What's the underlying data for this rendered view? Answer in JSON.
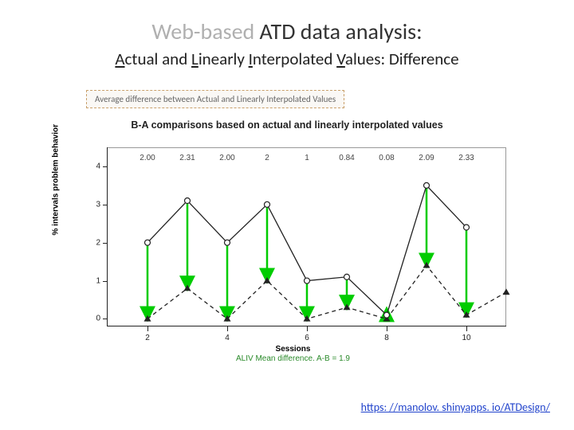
{
  "title_faded": "Web-based ",
  "title_main": "ATD data analysis:",
  "subtitle_parts": [
    "A",
    "ctual and ",
    "L",
    "inearly ",
    "I",
    "nterpolated ",
    "V",
    "alues: Difference"
  ],
  "legend_text": "Average difference between Actual and Linearly Interpolated Values",
  "chart_title": "B-A comparisons based on actual and linearly interpolated values",
  "y_axis_title": "% intervals problem behavior",
  "x_axis_title": "Sessions",
  "aliv_text": "ALIV Mean difference. A-B =  1.9",
  "footer_url": "https: //manolov. shinyapps. io/ATDesign/",
  "chart_data": {
    "type": "line",
    "xlabel": "Sessions",
    "ylabel": "% intervals problem behavior",
    "x_ticks": [
      2,
      4,
      6,
      8,
      10
    ],
    "y_ticks": [
      0,
      1,
      2,
      3,
      4
    ],
    "ylim": [
      -0.2,
      4.5
    ],
    "xlim": [
      1,
      11
    ],
    "series": [
      {
        "name": "upper (open circles, solid)",
        "style": "solid",
        "marker": "open-circle",
        "x": [
          2,
          3,
          4,
          5,
          6,
          7,
          8,
          9,
          10
        ],
        "y": [
          2.0,
          3.1,
          2.0,
          3.0,
          1.0,
          1.1,
          0.1,
          3.5,
          2.4
        ]
      },
      {
        "name": "lower (triangles, dashed)",
        "style": "dashed",
        "marker": "triangle",
        "x": [
          2,
          3,
          4,
          5,
          6,
          7,
          8,
          9,
          10,
          11
        ],
        "y": [
          0.0,
          0.8,
          0.0,
          1.0,
          0.0,
          0.3,
          0.0,
          1.4,
          0.1,
          0.7
        ]
      }
    ],
    "bar_labels": {
      "x": [
        2,
        3,
        4,
        5,
        6,
        7,
        8,
        9,
        10
      ],
      "text": [
        "2.00",
        "2.31",
        "2.00",
        "2",
        "1",
        "0.84",
        "0.08",
        "2.09",
        "2.33"
      ]
    },
    "arrows_color": "#00cc00"
  }
}
